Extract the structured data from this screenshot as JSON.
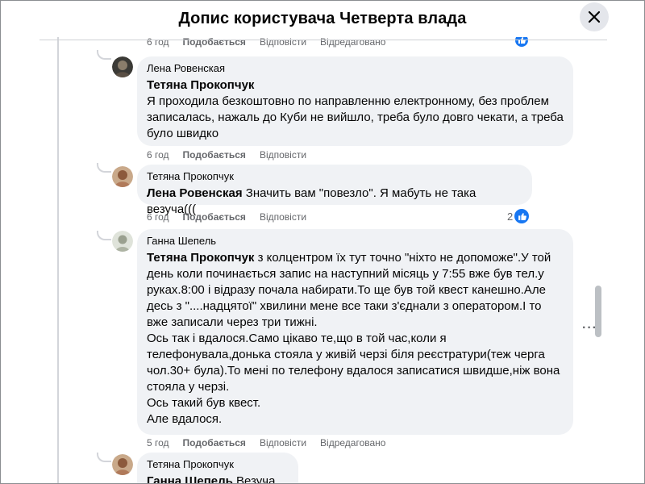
{
  "header": {
    "title": "Допис користувача Четверта влада"
  },
  "top_actions": {
    "time": "6 год",
    "like": "Подобається",
    "reply": "Відповісти",
    "edited": "Відредаговано"
  },
  "comments": [
    {
      "author": "Лена Ровенская",
      "mention": "Тетяна Прокопчук",
      "text": "Я проходила безкоштовно по направленню електронному, без проблем записалась, нажаль до Куби не вийшло, треба було довго чекати, а треба було швидко",
      "time": "6 год",
      "like": "Подобається",
      "reply": "Відповісти"
    },
    {
      "author": "Тетяна Прокопчук",
      "mention": "Лена Ровенская",
      "text": " Значить вам \"повезло\". Я мабуть не така везуча(((",
      "time": "6 год",
      "like": "Подобається",
      "reply": "Відповісти",
      "reactions": "2"
    },
    {
      "author": "Ганна Шепель",
      "mention": "Тетяна Прокопчук",
      "text": " з колцентром їх тут точно \"ніхто не допоможе\".У той день коли починається запис на наступний місяць у 7:55 вже був тел.у руках.8:00 і відразу почала набирати.То ще був той квест канешно.Але десь з \"....надцятої\" хвилини мене все таки з'єднали з оператором.І то вже записали через три тижні.\nОсь так і вдалося.Само цікаво те,що в той час,коли я телефонувала,донька стояла у живій черзі біля реєстратури(теж черга чол.30+ була).То мені по телефону вдалося записатися швидше,ніж вона стояла у черзі.\nОсь такий був квест.\nАле вдалося.",
      "time": "5 год",
      "like": "Подобається",
      "reply": "Відповісти",
      "edited": "Відредаговано"
    },
    {
      "author": "Тетяна Прокопчук",
      "mention": "Ганна Шепель",
      "text": " Везуча ви"
    }
  ],
  "icons": {
    "close": "close-icon",
    "like": "thumbs-up-icon",
    "more": "more-options-icon"
  },
  "colors": {
    "accent": "#1877f2",
    "bubble": "#f0f2f5",
    "meta": "#65676b"
  }
}
